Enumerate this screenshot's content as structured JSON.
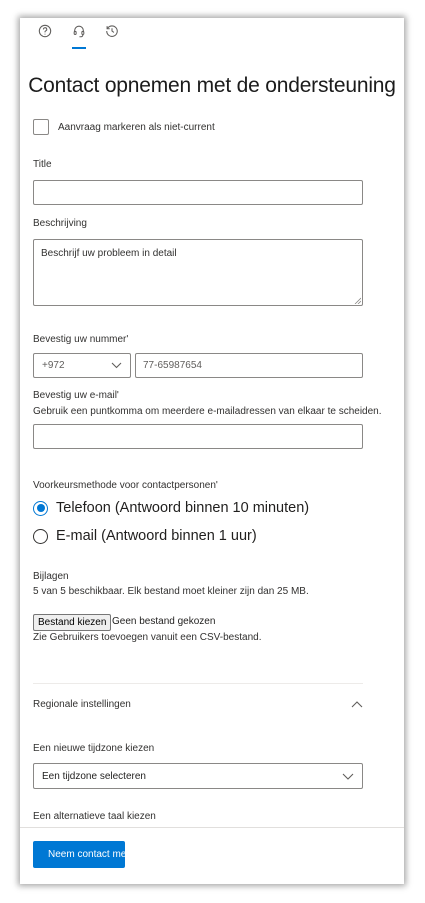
{
  "tabs": [
    {
      "icon": "help-icon"
    },
    {
      "icon": "headset-icon",
      "active": true
    },
    {
      "icon": "history-icon"
    }
  ],
  "title": "Contact opnemen met de ondersteuning",
  "mark_checkbox": {
    "label": "Aanvraag markeren als niet-current",
    "checked": false
  },
  "title_field": {
    "label": "Title",
    "value": ""
  },
  "description_field": {
    "label": "Beschrijving",
    "value": "Beschrijf uw probleem in detail"
  },
  "phone_field": {
    "label": "Bevestig uw nummer'",
    "country_code": "+972",
    "number": "77-65987654"
  },
  "email_field": {
    "label": "Bevestig uw e-mail'",
    "hint": "Gebruik een puntkomma om meerdere e-mailadressen van elkaar te scheiden.",
    "value": ""
  },
  "contact_method": {
    "label": "Voorkeursmethode voor contactpersonen'",
    "options": [
      {
        "label": "Telefoon (Antwoord binnen 10 minuten)",
        "selected": true
      },
      {
        "label": "E-mail (Antwoord binnen 1 uur)",
        "selected": false
      }
    ]
  },
  "attachments": {
    "label": "Bijlagen",
    "available_count": "5",
    "available_text": "van 5 beschikbaar. Elk bestand moet kleiner zijn dan 25 MB.",
    "choose_button": "Bestand kiezen",
    "status": "Geen bestand gekozen",
    "csv_note": "Zie Gebruikers toevoegen vanuit een CSV-bestand."
  },
  "regional": {
    "heading": "Regionale instellingen",
    "timezone_label": "Een nieuwe tijdzone kiezen",
    "timezone_value": "Een tijdzone selecteren",
    "language_label": "Een alternatieve taal kiezen"
  },
  "submit_button": "Neem contact met ons op",
  "colors": {
    "accent": "#0078d4",
    "border": "#8a8886"
  }
}
